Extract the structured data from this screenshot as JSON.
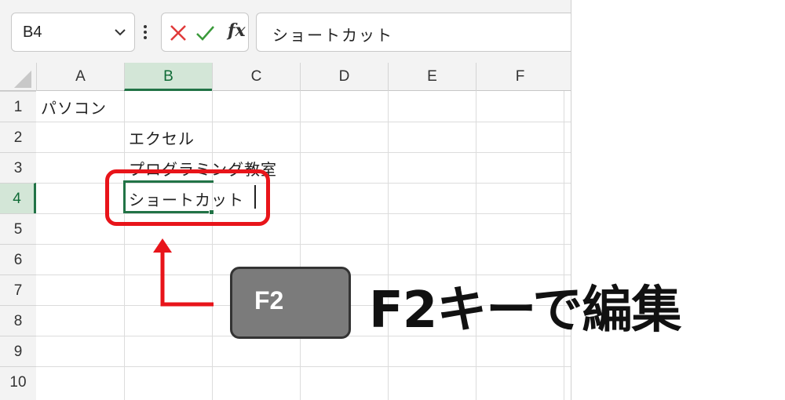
{
  "formula_bar": {
    "name_box_value": "B4",
    "formula_value": "ショートカット",
    "fx_label": "fx"
  },
  "columns": [
    "A",
    "B",
    "C",
    "D",
    "E",
    "F"
  ],
  "selected_column": "B",
  "rows": [
    "1",
    "2",
    "3",
    "4",
    "5",
    "6",
    "7",
    "8",
    "9",
    "10"
  ],
  "selected_row": "4",
  "cells": {
    "A1": "パソコン",
    "B2": "エクセル",
    "B3": "プログラミング教室",
    "B4": "ショートカット"
  },
  "annotation": {
    "key_label": "F2",
    "caption": "F2キーで編集"
  },
  "colors": {
    "excel_green": "#217346",
    "highlight_red": "#e8141a",
    "key_gray": "#7b7b7b"
  }
}
